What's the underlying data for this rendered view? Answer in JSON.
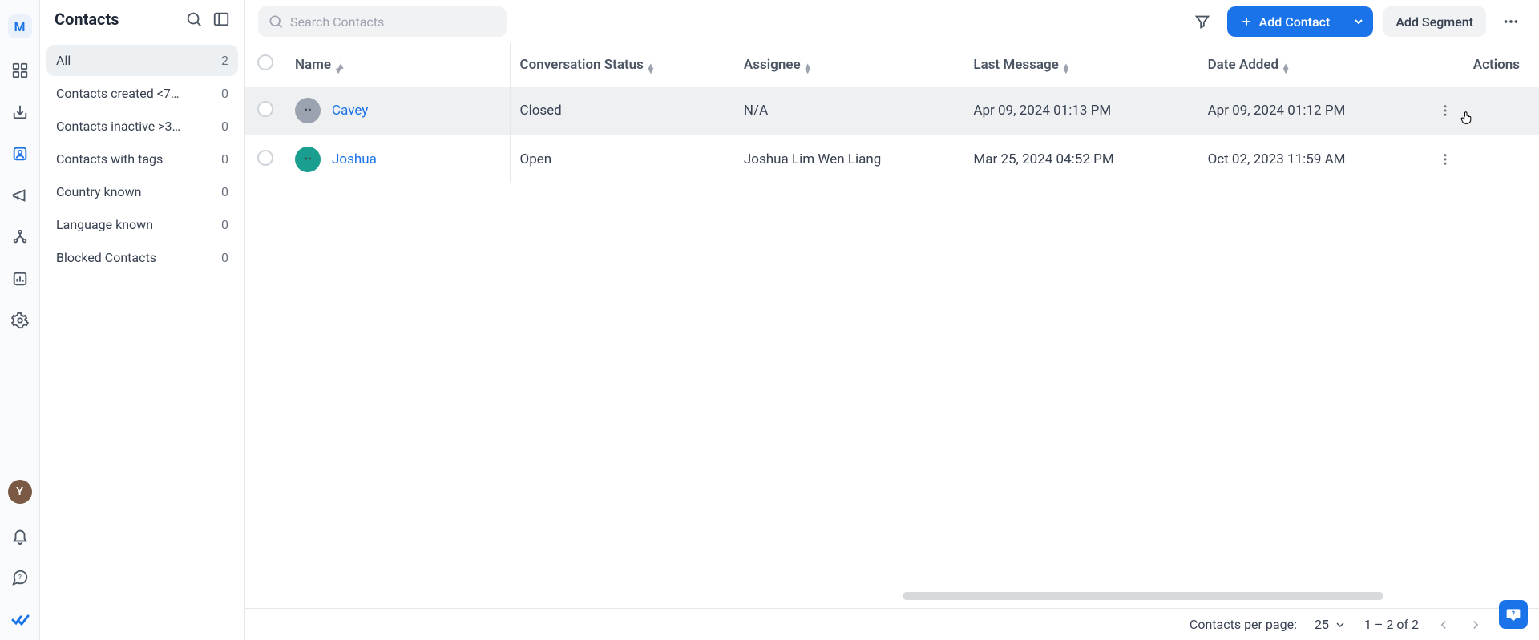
{
  "navRail": {
    "workspaceInitial": "M",
    "userInitial": "Y"
  },
  "sidebar": {
    "title": "Contacts",
    "segments": [
      {
        "label": "All",
        "count": 2,
        "active": true
      },
      {
        "label": "Contacts created <7…",
        "count": 0
      },
      {
        "label": "Contacts inactive >3…",
        "count": 0
      },
      {
        "label": "Contacts with tags",
        "count": 0
      },
      {
        "label": "Country known",
        "count": 0
      },
      {
        "label": "Language known",
        "count": 0
      },
      {
        "label": "Blocked Contacts",
        "count": 0
      }
    ]
  },
  "toolbar": {
    "search_placeholder": "Search Contacts",
    "add_contact_label": "Add Contact",
    "add_segment_label": "Add Segment"
  },
  "table": {
    "headers": {
      "name": "Name",
      "conversation_status": "Conversation Status",
      "assignee": "Assignee",
      "last_message": "Last Message",
      "date_added": "Date Added",
      "actions": "Actions"
    },
    "rows": [
      {
        "name": "Cavey",
        "avatar_color": "grey",
        "conversation_status": "Closed",
        "assignee": "N/A",
        "last_message": "Apr 09, 2024 01:13 PM",
        "date_added": "Apr 09, 2024 01:12 PM",
        "hover": true
      },
      {
        "name": "Joshua",
        "avatar_color": "teal",
        "conversation_status": "Open",
        "assignee": "Joshua Lim Wen Liang",
        "last_message": "Mar 25, 2024 04:52 PM",
        "date_added": "Oct 02, 2023 11:59 AM"
      }
    ]
  },
  "footer": {
    "perpage_label": "Contacts per page:",
    "perpage_value": "25",
    "range_text": "1 – 2 of 2"
  }
}
